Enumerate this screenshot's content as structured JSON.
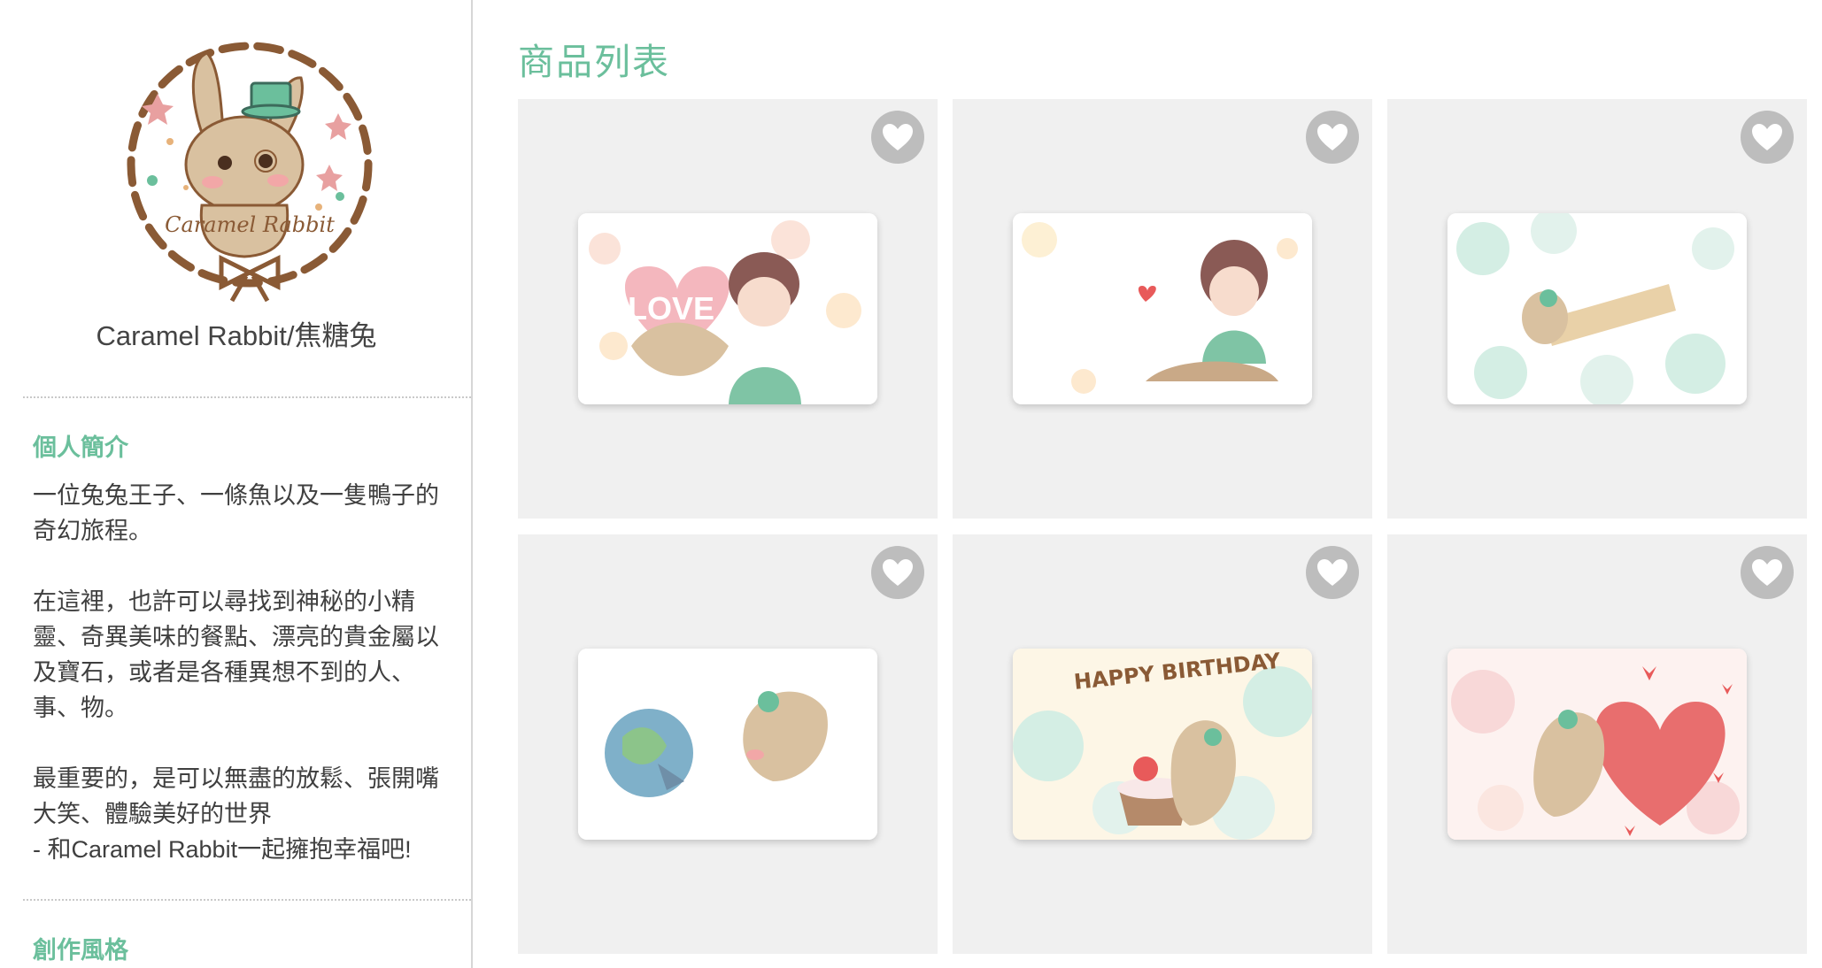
{
  "sidebar": {
    "logo_text": "Caramel Rabbit",
    "artist_name": "Caramel Rabbit/焦糖兔",
    "intro_title": "個人簡介",
    "bio": [
      "一位兔兔王子、一條魚以及一隻鴨子的奇幻旅程。",
      "在這裡，也許可以尋找到神秘的小精靈、奇異美味的餐點、漂亮的貴金屬以及寶石，或者是各種異想不到的人、事、物。",
      "最重要的，是可以無盡的放鬆、張開嘴大笑、體驗美好的世界\n- 和Caramel Rabbit一起擁抱幸福吧!"
    ],
    "style_title": "創作風格"
  },
  "main": {
    "title": "商品列表",
    "products": [
      {
        "card_text": "LOVE",
        "favorite_icon": "heart-icon"
      },
      {
        "card_text": "",
        "favorite_icon": "heart-icon"
      },
      {
        "card_text": "",
        "favorite_icon": "heart-icon"
      },
      {
        "card_text": "",
        "favorite_icon": "heart-icon"
      },
      {
        "card_text": "HAPPY BIRTHDAY",
        "favorite_icon": "heart-icon"
      },
      {
        "card_text": "",
        "favorite_icon": "heart-icon"
      }
    ]
  },
  "colors": {
    "accent": "#6bbf9c",
    "tile_bg": "#f0f0f0",
    "favorite_bg": "#bdbdbd",
    "logo_brown": "#8a5a35"
  }
}
